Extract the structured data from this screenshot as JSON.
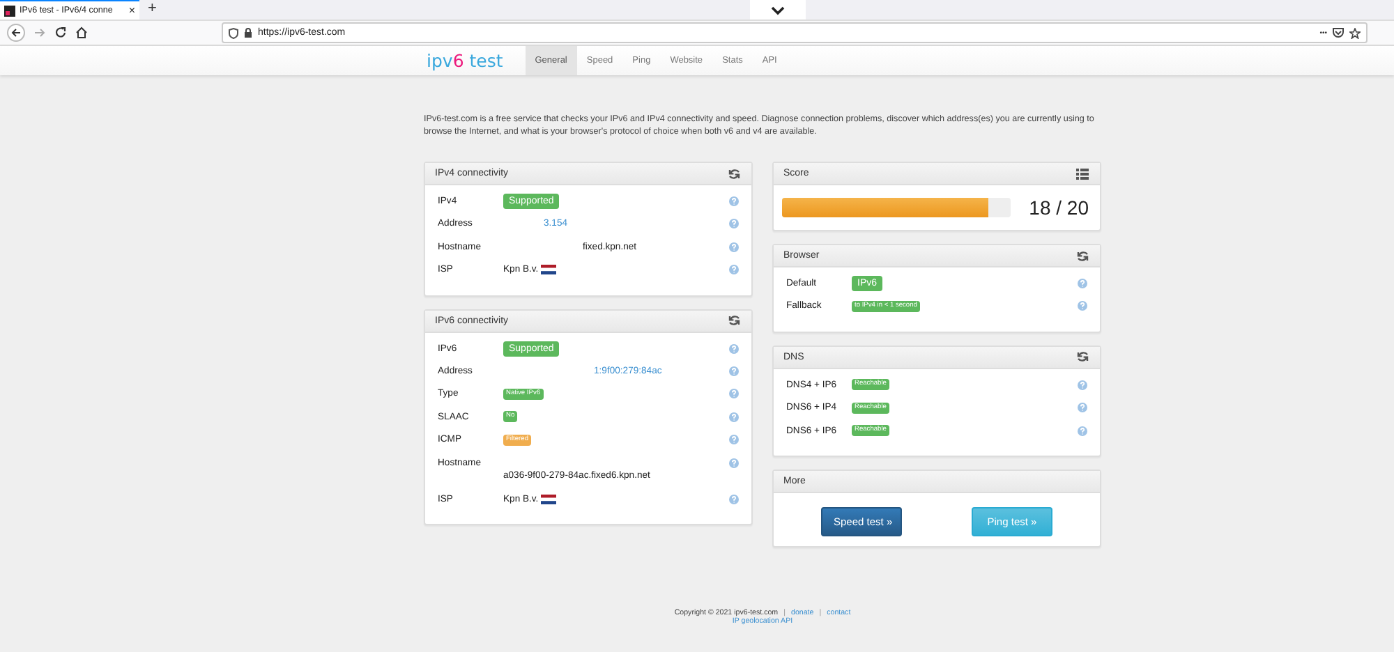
{
  "browser": {
    "tab_title": "IPv6 test - IPv6/4 conne",
    "tab_close": "×",
    "new_tab": "+",
    "url": "https://ipv6-test.com",
    "menu_dots": "•••"
  },
  "site": {
    "logo": {
      "prefix": "ipv",
      "accent": "6",
      "suffix": " test"
    },
    "nav": [
      {
        "label": "General",
        "selected": true
      },
      {
        "label": "Speed",
        "selected": false
      },
      {
        "label": "Ping",
        "selected": false
      },
      {
        "label": "Website",
        "selected": false
      },
      {
        "label": "Stats",
        "selected": false
      },
      {
        "label": "API",
        "selected": false
      }
    ]
  },
  "intro": "IPv6-test.com is a free service that checks your IPv6 and IPv4 connectivity and speed. Diagnose connection problems, discover which address(es) you are currently using to browse the Internet, and what is your browser's protocol of choice when both v6 and v4 are available.",
  "left_panels": [
    {
      "title": "IPv4 connectivity",
      "rows": [
        {
          "label": "IPv4",
          "kind": "badge",
          "value": "Supported",
          "color": "#5cb85c"
        },
        {
          "label": "Address",
          "kind": "link",
          "value": "3.154"
        },
        {
          "label": "Hostname",
          "kind": "text",
          "value": "fixed.kpn.net"
        },
        {
          "label": "ISP",
          "kind": "isp",
          "value": "Kpn B.v."
        }
      ]
    },
    {
      "title": "IPv6 connectivity",
      "rows": [
        {
          "label": "IPv6",
          "kind": "badge",
          "value": "Supported",
          "color": "#5cb85c"
        },
        {
          "label": "Address",
          "kind": "link",
          "value": "1:9f00:279:84ac"
        },
        {
          "label": "Type",
          "kind": "tag",
          "value": "Native IPv6",
          "color": "#5cb85c"
        },
        {
          "label": "SLAAC",
          "kind": "tag",
          "value": "No",
          "color": "#5cb85c"
        },
        {
          "label": "ICMP",
          "kind": "tag",
          "value": "Filtered",
          "color": "#f0ad4e"
        },
        {
          "label": "Hostname",
          "kind": "block",
          "value": "a036-9f00-279-84ac.fixed6.kpn.net"
        },
        {
          "label": "ISP",
          "kind": "isp",
          "value": "Kpn B.v."
        }
      ]
    }
  ],
  "score": {
    "title": "Score",
    "level": 0.9,
    "reading": "18 / 20"
  },
  "right_panels": [
    {
      "title": "Browser",
      "rows": [
        {
          "label": "Default",
          "kind": "badge",
          "value": "IPv6",
          "color": "#5cb85c"
        },
        {
          "label": "Fallback",
          "kind": "tag",
          "value": "to IPv4 in < 1 second",
          "color": "#5cb85c"
        }
      ]
    },
    {
      "title": "DNS",
      "rows": [
        {
          "label": "DNS4 + IP6",
          "kind": "tag",
          "value": "Reachable",
          "color": "#5cb85c"
        },
        {
          "label": "DNS6 + IP4",
          "kind": "tag",
          "value": "Reachable",
          "color": "#5cb85c"
        },
        {
          "label": "DNS6 + IP6",
          "kind": "tag",
          "value": "Reachable",
          "color": "#5cb85c"
        }
      ]
    }
  ],
  "more": {
    "title": "More",
    "buttons": [
      {
        "label": "Speed test »",
        "kind": "primary"
      },
      {
        "label": "Ping test »",
        "kind": "info"
      }
    ]
  },
  "footer": {
    "copyright": "Copyright © 2021 ipv6-test.com",
    "separators": [
      "|",
      "|"
    ],
    "links": [
      "donate",
      "contact"
    ],
    "api_link": "IP geolocation API"
  }
}
